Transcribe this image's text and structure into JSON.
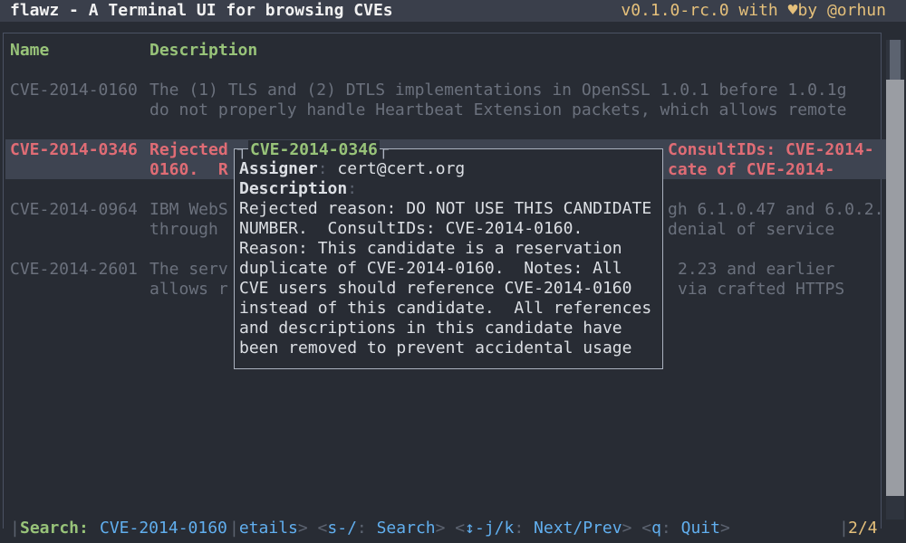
{
  "app": {
    "title": "flawz - A Terminal UI for browsing CVEs",
    "version_prefix": "v0.1.0-rc.0 with ",
    "heart": "♥",
    "version_suffix": "by @orhun"
  },
  "table": {
    "headers": {
      "name": "Name",
      "description": "Description"
    },
    "rows": [
      {
        "id": "CVE-2014-0160",
        "line1": "The (1) TLS and (2) DTLS implementations in OpenSSL 1.0.1 before 1.0.1g",
        "line2": "do not properly handle Heartbeat Extension packets, which allows remote"
      },
      {
        "id": "CVE-2014-0346",
        "line1_left": "Rejected ",
        "line1_right": "ConsultIDs: CVE-2014-",
        "line2_left": "0160.  R",
        "line2_right": "cate of CVE-2014-"
      },
      {
        "id": "CVE-2014-0964",
        "line1_left": "IBM WebS",
        "line1_right": "gh 6.1.0.47 and 6.0.2.",
        "line2_left": "through ",
        "line2_right": "denial of service"
      },
      {
        "id": "CVE-2014-2601",
        "line1_left": "The serv",
        "line1_right": "2.23 and earlier",
        "line2_left": "allows r",
        "line2_right": "via crafted HTTPS"
      }
    ]
  },
  "popup": {
    "title": "CVE-2014-0346",
    "assigner_label": "Assigner",
    "assigner_value": "cert@cert.org",
    "description_label": "Description",
    "description_lines": [
      "Rejected reason: DO NOT USE THIS CANDIDATE",
      "NUMBER.  ConsultIDs: CVE-2014-0160.",
      "Reason: This candidate is a reservation",
      "duplicate of CVE-2014-0160.  Notes: All",
      "CVE users should reference CVE-2014-0160",
      "instead of this candidate.  All references",
      "and descriptions in this candidate have",
      "been removed to prevent accidental usage"
    ]
  },
  "footer": {
    "search_label": "Search:",
    "search_value": "CVE-2014-0160",
    "details_fragment": "etails",
    "search_key": "s-/",
    "search_action": "Search",
    "nav_key": "↕-j/k",
    "nav_action": "Next/Prev",
    "quit_key": "q",
    "quit_action": "Quit",
    "page": "2/4"
  }
}
